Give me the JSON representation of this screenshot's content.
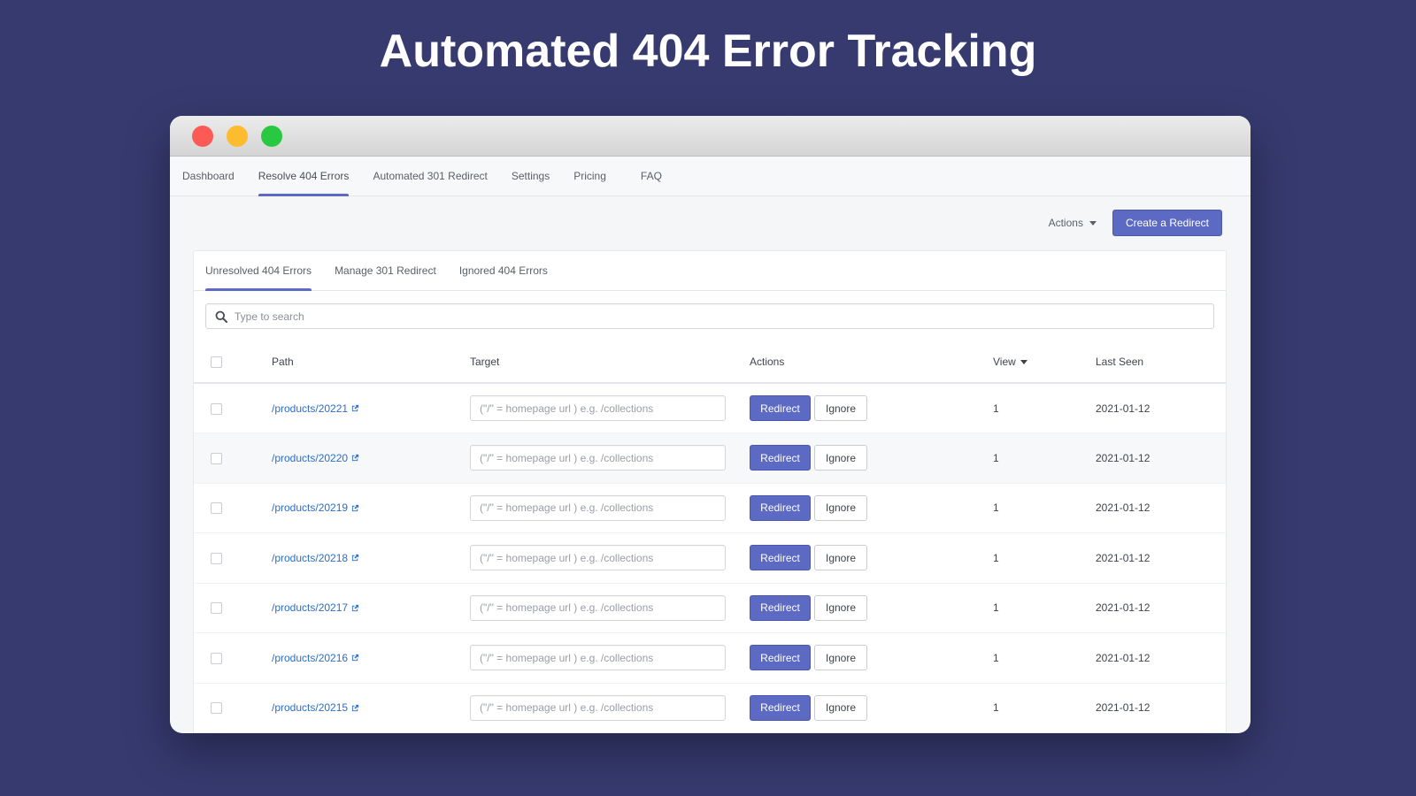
{
  "headline": "Automated 404 Error Tracking",
  "colors": {
    "background": "#363a6f",
    "accent": "#5c6ac4",
    "link": "#2c6ecb"
  },
  "window": {
    "controls": [
      "close",
      "minimize",
      "maximize"
    ]
  },
  "topnav": {
    "items": [
      {
        "label": "Dashboard",
        "active": false
      },
      {
        "label": "Resolve 404 Errors",
        "active": true
      },
      {
        "label": "Automated 301 Redirect",
        "active": false
      },
      {
        "label": "Settings",
        "active": false
      },
      {
        "label": "Pricing",
        "active": false
      },
      {
        "label": "FAQ",
        "active": false
      }
    ]
  },
  "toolbar": {
    "actions_label": "Actions",
    "create_label": "Create a Redirect"
  },
  "subtabs": {
    "items": [
      {
        "label": "Unresolved 404 Errors",
        "active": true
      },
      {
        "label": "Manage 301 Redirect",
        "active": false
      },
      {
        "label": "Ignored 404 Errors",
        "active": false
      }
    ]
  },
  "search": {
    "placeholder": "Type to search",
    "icon": "search-icon"
  },
  "table": {
    "headers": {
      "path": "Path",
      "target": "Target",
      "actions": "Actions",
      "view": "View",
      "last_seen": "Last Seen"
    },
    "target_placeholder": "(\"/\" = homepage url ) e.g. /collections",
    "redirect_label": "Redirect",
    "ignore_label": "Ignore",
    "rows": [
      {
        "path": "/products/20221",
        "view": "1",
        "last_seen": "2021-01-12"
      },
      {
        "path": "/products/20220",
        "view": "1",
        "last_seen": "2021-01-12"
      },
      {
        "path": "/products/20219",
        "view": "1",
        "last_seen": "2021-01-12"
      },
      {
        "path": "/products/20218",
        "view": "1",
        "last_seen": "2021-01-12"
      },
      {
        "path": "/products/20217",
        "view": "1",
        "last_seen": "2021-01-12"
      },
      {
        "path": "/products/20216",
        "view": "1",
        "last_seen": "2021-01-12"
      },
      {
        "path": "/products/20215",
        "view": "1",
        "last_seen": "2021-01-12"
      }
    ]
  }
}
